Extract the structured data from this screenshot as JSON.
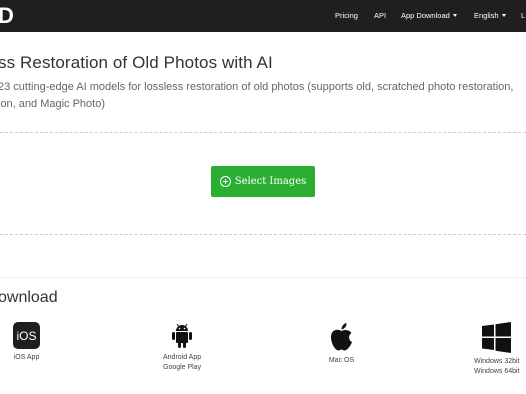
{
  "navbar": {
    "logo": "D",
    "items": [
      "Pricing",
      "API",
      "App Download",
      "English",
      "L"
    ]
  },
  "hero": {
    "title": "ss Restoration of Old Photos with AI",
    "subtitle_line1": "23 cutting-edge AI models for lossless restoration of old photos (supports old, scratched photo restoration,",
    "subtitle_line2": "ion, and Magic Photo)"
  },
  "upload": {
    "button_label": "Select Images",
    "icon": "plus-circle-icon"
  },
  "download": {
    "heading": "ownload",
    "ios": {
      "icon_text": "iOS",
      "label": "iOS App"
    },
    "android": {
      "line1": "Android App",
      "line2": "Google Play"
    },
    "mac": {
      "label": "Mac OS"
    },
    "windows": {
      "line1": "Windows 32bit",
      "line2": "Windows 64bit"
    }
  },
  "colors": {
    "navbar_bg": "#1f1f1f",
    "button_green": "#2cae33"
  }
}
